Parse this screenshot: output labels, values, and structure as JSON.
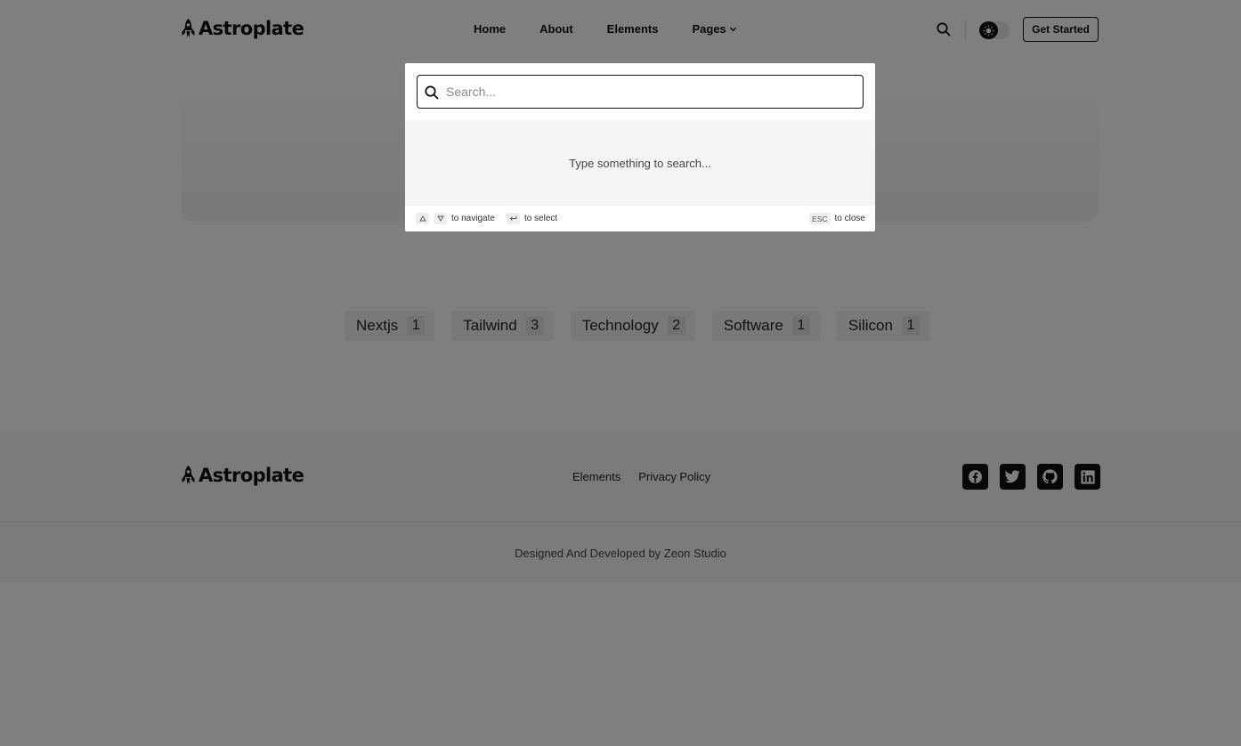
{
  "header": {
    "brand": "Astroplate",
    "nav": [
      "Home",
      "About",
      "Elements",
      "Pages"
    ],
    "cta_label": "Get Started"
  },
  "tags": [
    {
      "name": "Nextjs",
      "count": "1"
    },
    {
      "name": "Tailwind",
      "count": "3"
    },
    {
      "name": "Technology",
      "count": "2"
    },
    {
      "name": "Software",
      "count": "1"
    },
    {
      "name": "Silicon",
      "count": "1"
    }
  ],
  "footer": {
    "brand": "Astroplate",
    "links": [
      "Elements",
      "Privacy Policy"
    ],
    "socials": [
      "facebook-icon",
      "twitter-icon",
      "github-icon",
      "linkedin-icon"
    ],
    "copyright": "Designed And Developed by Zeon Studio"
  },
  "search_modal": {
    "placeholder": "Search...",
    "empty_message": "Type something to search...",
    "hint_navigate": "to navigate",
    "hint_select": "to select",
    "esc_key": "ESC",
    "hint_close": "to close"
  }
}
